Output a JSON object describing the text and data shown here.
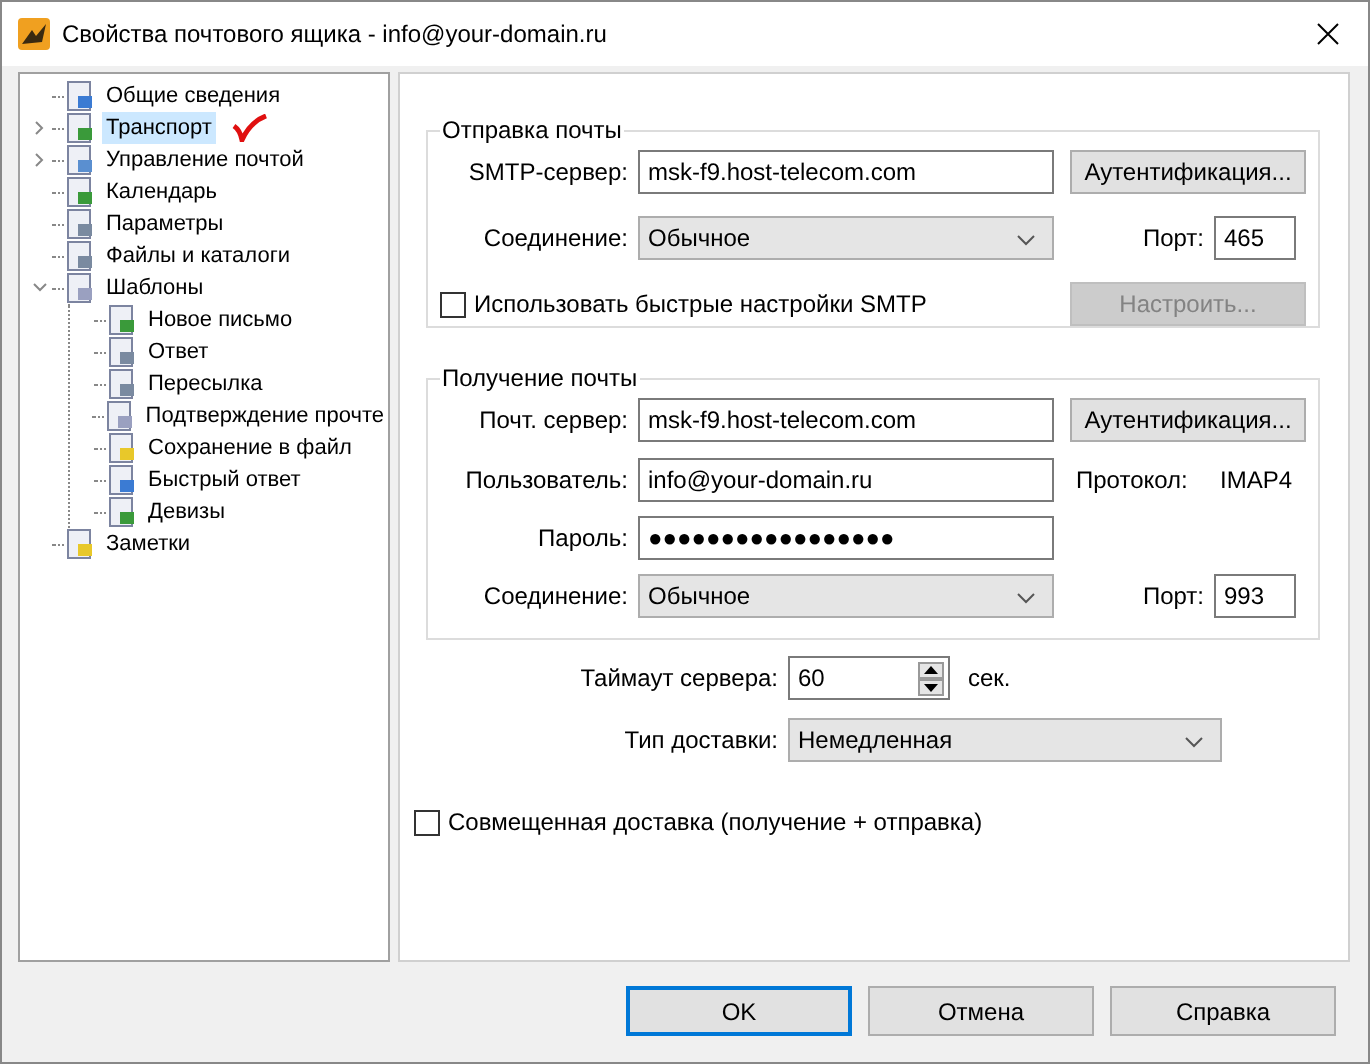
{
  "window": {
    "title": "Свойства почтового ящика - info@your-domain.ru"
  },
  "tree": {
    "items": [
      {
        "label": "Общие сведения",
        "selected": false,
        "marked": false
      },
      {
        "label": "Транспорт",
        "selected": true,
        "expanded": false,
        "marked": true
      },
      {
        "label": "Управление почтой",
        "selected": false,
        "expanded": false,
        "marked": false
      },
      {
        "label": "Календарь",
        "selected": false,
        "marked": false
      },
      {
        "label": "Параметры",
        "selected": false,
        "marked": false
      },
      {
        "label": "Файлы и каталоги",
        "selected": false,
        "marked": false
      },
      {
        "label": "Шаблоны",
        "selected": false,
        "expanded": true,
        "marked": false,
        "children": [
          {
            "label": "Новое письмо",
            "selected": false
          },
          {
            "label": "Ответ",
            "selected": false
          },
          {
            "label": "Пересылка",
            "selected": false
          },
          {
            "label": "Подтверждение прочте",
            "selected": false
          },
          {
            "label": "Сохранение в файл",
            "selected": false
          },
          {
            "label": "Быстрый ответ",
            "selected": false
          },
          {
            "label": "Девизы",
            "selected": false
          }
        ]
      },
      {
        "label": "Заметки",
        "selected": false,
        "marked": false
      }
    ]
  },
  "sending": {
    "legend": "Отправка почты",
    "server_label": "SMTP-сервер:",
    "server": "msk-f9.host-telecom.com",
    "auth_button": "Аутентификация...",
    "connection_label": "Соединение:",
    "connection": "Обычное",
    "port_label": "Порт:",
    "port": "465",
    "quick_setup": {
      "label": "Использовать быстрые настройки SMTP",
      "checked": false
    },
    "configure_button": {
      "label": "Настроить...",
      "disabled": true
    }
  },
  "receiving": {
    "legend": "Получение почты",
    "server_label": "Почт. сервер:",
    "server": "msk-f9.host-telecom.com",
    "auth_button": "Аутентификация...",
    "user_label": "Пользователь:",
    "user": "info@your-domain.ru",
    "protocol_label": "Протокол:",
    "protocol": "IMAP4",
    "password_label": "Пароль:",
    "password": "●●●●●●●●●●●●●●●●●",
    "connection_label": "Соединение:",
    "connection": "Обычное",
    "port_label": "Порт:",
    "port": "993"
  },
  "timeout": {
    "label": "Таймаут сервера:",
    "value": "60",
    "unit": "сек."
  },
  "delivery": {
    "label": "Тип доставки:",
    "value": "Немедленная"
  },
  "combined": {
    "label": "Совмещенная доставка (получение + отправка)",
    "checked": false
  },
  "buttons": [
    {
      "label": "OK",
      "default": true
    },
    {
      "label": "Отмена",
      "default": false
    },
    {
      "label": "Справка",
      "default": false
    }
  ]
}
